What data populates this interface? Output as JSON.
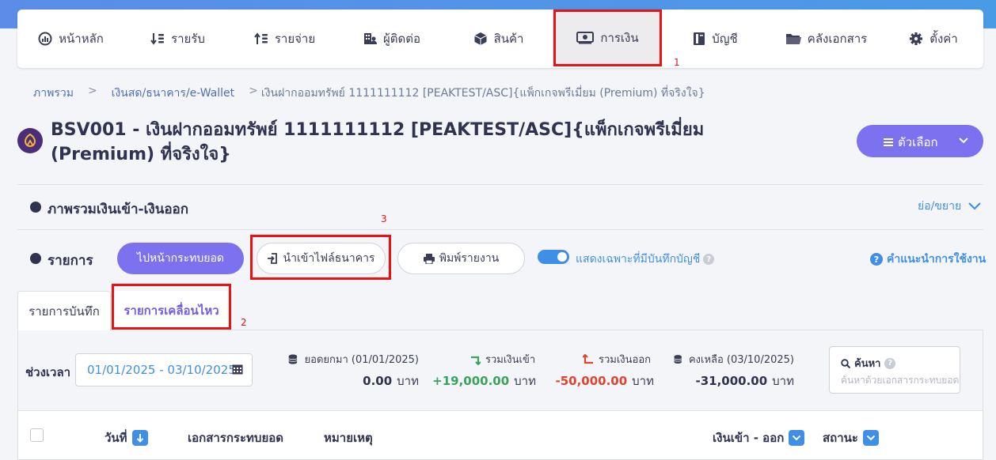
{
  "nav": {
    "items": [
      {
        "label": "หน้าหลัก",
        "icon": "dashboard-icon"
      },
      {
        "label": "รายรับ",
        "icon": "income-icon"
      },
      {
        "label": "รายจ่าย",
        "icon": "expense-icon"
      },
      {
        "label": "ผู้ติดต่อ",
        "icon": "contacts-icon"
      },
      {
        "label": "สินค้า",
        "icon": "product-box-icon"
      },
      {
        "label": "การเงิน",
        "icon": "money-icon",
        "active": true
      },
      {
        "label": "บัญชี",
        "icon": "ledger-book-icon"
      },
      {
        "label": "คลังเอกสาร",
        "icon": "folder-icon"
      },
      {
        "label": "ตั้งค่า",
        "icon": "gear-icon"
      }
    ]
  },
  "annotations": {
    "mark1": "1",
    "mark2": "2",
    "mark3": "3",
    "color": "#ee1111"
  },
  "breadcrumb": {
    "item1": "ภาพรวม",
    "sep": ">",
    "item2": "เงินสด/ธนาคาร/e-Wallet",
    "item3": "เงินฝากออมทรัพย์ 1111111112 [PEAKTEST/ASC]{แพ็กเกจพรีเมี่ยม (Premium) ที่จริงใจ}"
  },
  "page": {
    "title": "BSV001 - เงินฝากออมทรัพย์ 1111111112 [PEAKTEST/ASC]{แพ็กเกจพรีเมี่ยม (Premium) ที่จริงใจ}",
    "options_label": "ตัวเลือก",
    "accent": "#7c72ef"
  },
  "overview": {
    "title": "ภาพรวมเงินเข้า-เงินออก",
    "toggle_label": "ย่อ/ขยาย"
  },
  "transactions": {
    "title": "รายการ",
    "btn_reconcile": "ไปหน้ากระทบยอด",
    "btn_import": "นำเข้าไฟล์ธนาคาร",
    "btn_print": "พิมพ์รายงาน",
    "toggle_label": "แสดงเฉพาะที่มีบันทึกบัญชี",
    "guide_label": "คำแนะนำการใช้งาน"
  },
  "tabs": {
    "tab1": "รายการบันทึก",
    "tab2": "รายการเคลื่อนไหว"
  },
  "filters": {
    "period_label": "ช่วงเวลา",
    "date_range": "01/01/2025 - 03/10/2025",
    "search_label": "ค้นหา",
    "search_placeholder": "ค้นหาด้วยเอกสารกระทบยอด"
  },
  "stats": {
    "brought_forward": {
      "label": "ยอดยกมา (01/01/2025)",
      "value": "0.00",
      "unit": "บาท"
    },
    "total_in": {
      "label": "รวมเงินเข้า",
      "value": "+19,000.00",
      "unit": "บาท",
      "color": "#3aa35b"
    },
    "total_out": {
      "label": "รวมเงินออก",
      "value": "-50,000.00",
      "unit": "บาท",
      "color": "#e0442f"
    },
    "balance": {
      "label": "คงเหลือ (03/10/2025)",
      "value": "-31,000.00",
      "unit": "บาท"
    }
  },
  "table": {
    "col_date": "วันที่",
    "col_reconcile_doc": "เอกสารกระทบยอด",
    "col_note": "หมายเหตุ",
    "col_in_out": "เงินเข้า - ออก",
    "col_status": "สถานะ"
  }
}
